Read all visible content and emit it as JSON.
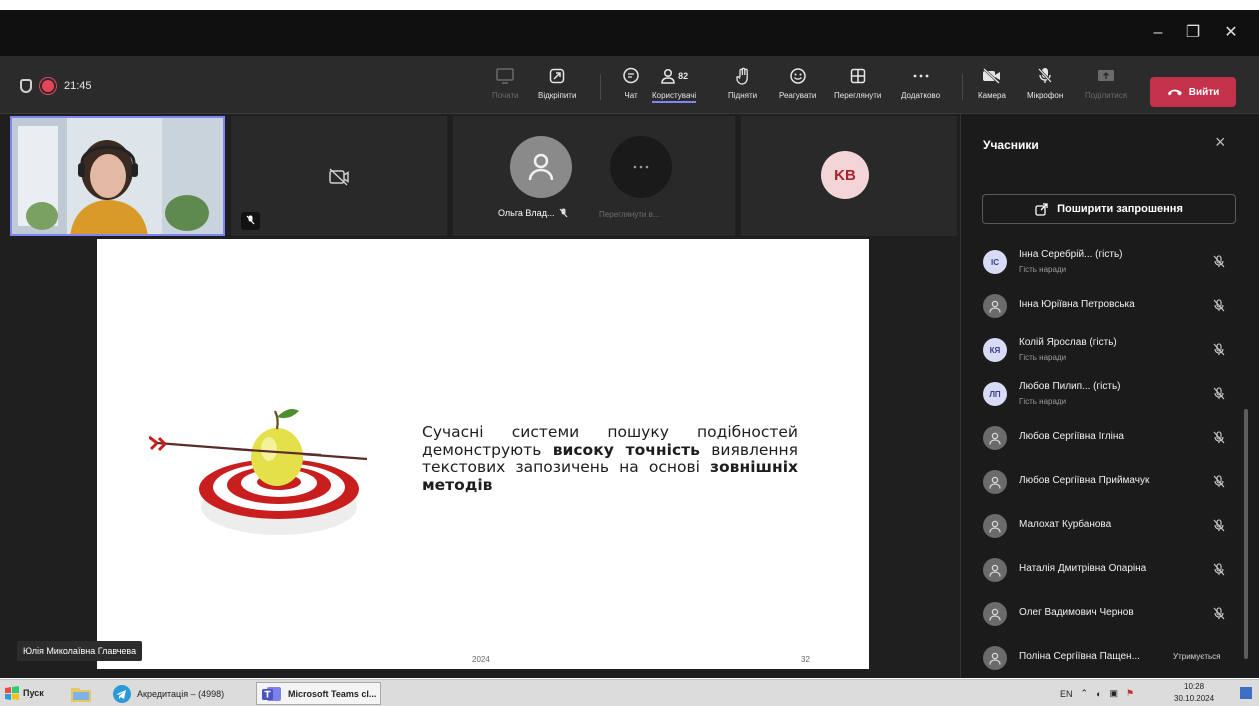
{
  "window": {
    "minimize": "–",
    "restore": "❐",
    "close": "✕"
  },
  "meeting": {
    "timer": "21:45"
  },
  "toolbar": {
    "items": [
      {
        "label": "Почати",
        "icon": "screen-icon"
      },
      {
        "label": "Відкріпити",
        "icon": "unpin-icon"
      },
      {
        "label": "Чат",
        "icon": "chat-icon"
      },
      {
        "label": "Користувачі",
        "icon": "people-icon",
        "count": "82"
      },
      {
        "label": "Підняти",
        "icon": "hand-icon"
      },
      {
        "label": "Реагувати",
        "icon": "smile-icon"
      },
      {
        "label": "Переглянути",
        "icon": "grid-icon"
      },
      {
        "label": "Додатково",
        "icon": "more-icon"
      },
      {
        "label": "Камера",
        "icon": "camera-off-icon"
      },
      {
        "label": "Мікрофон",
        "icon": "mic-off-icon"
      },
      {
        "label": "Поділитися",
        "icon": "share-icon"
      }
    ],
    "leave_label": "Вийти"
  },
  "gallery": {
    "tile3_name": "Ольга Влад...",
    "tile3_more": "Переглянути в...",
    "tile4_initials": "KB"
  },
  "slide": {
    "text_plain_1": "Сучасні системи пошуку подібностей демонструють ",
    "text_bold_1": "високу точність",
    "text_plain_2": " виявлення текстових запозичень на основі ",
    "text_bold_2": "зовнішніх методів",
    "year": "2024",
    "page": "32"
  },
  "speaker_name": "Юлія Миколаївна Главчева",
  "panel": {
    "title": "Учасники",
    "invite_label": "Поширити запрошення",
    "participants": [
      {
        "initials": "IC",
        "name": "Інна Серебрій... (гість)",
        "sub": "Гість наради"
      },
      {
        "initials": "",
        "name": "Інна Юріївна Петровська",
        "sub": ""
      },
      {
        "initials": "КЯ",
        "name": "Колій Ярослав (гість)",
        "sub": "Гість наради"
      },
      {
        "initials": "ЛП",
        "name": "Любов Пилип... (гість)",
        "sub": "Гість наради"
      },
      {
        "initials": "",
        "name": "Любов Сергіївна Ігліна",
        "sub": ""
      },
      {
        "initials": "",
        "name": "Любов Сергіївна Приймачук",
        "sub": ""
      },
      {
        "initials": "",
        "name": "Малохат Курбанова",
        "sub": ""
      },
      {
        "initials": "",
        "name": "Наталія Дмитрівна Опаріна",
        "sub": ""
      },
      {
        "initials": "",
        "name": "Олег Вадимович Чернов",
        "sub": ""
      },
      {
        "initials": "",
        "name": "Поліна Сергіївна Пащен...",
        "sub": "",
        "status": "Утримується"
      }
    ]
  },
  "taskbar": {
    "start": "Пуск",
    "tasks": [
      {
        "label": "Акредитація – (4998)"
      },
      {
        "label": "Microsoft Teams cl..."
      }
    ],
    "lang": "EN",
    "time": "10:28",
    "date": "30.10.2024"
  },
  "colors": {
    "leave": "#c4314b",
    "accent": "#7f85f5",
    "record": "#e6445a"
  }
}
